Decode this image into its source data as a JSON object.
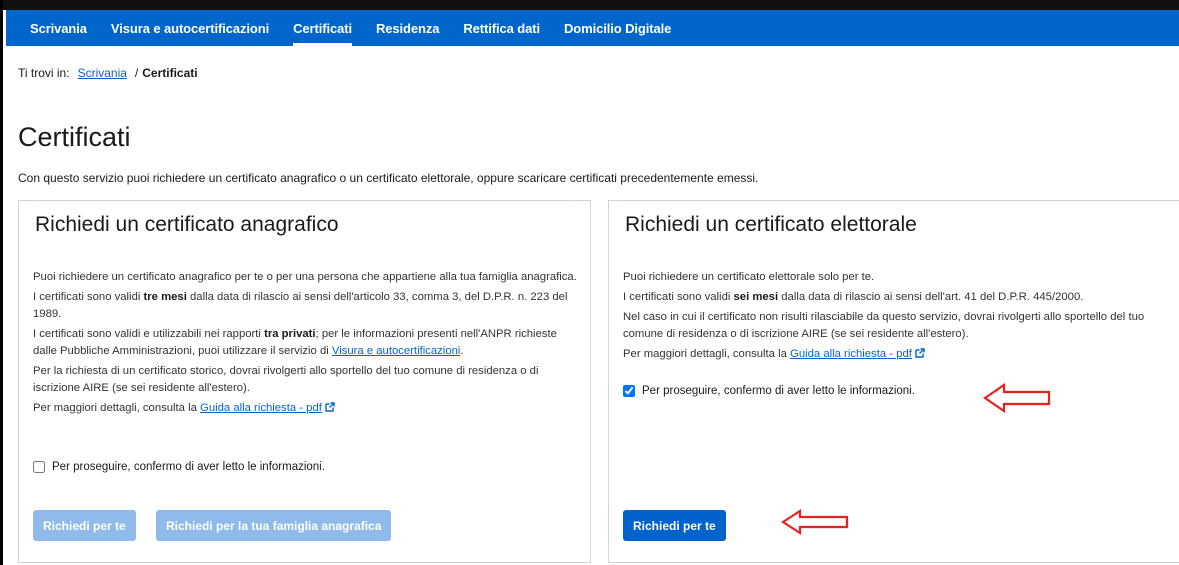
{
  "nav": {
    "items": [
      {
        "label": "Scrivania",
        "active": false
      },
      {
        "label": "Visura e autocertificazioni",
        "active": false
      },
      {
        "label": "Certificati",
        "active": true
      },
      {
        "label": "Residenza",
        "active": false
      },
      {
        "label": "Rettifica dati",
        "active": false
      },
      {
        "label": "Domicilio Digitale",
        "active": false
      }
    ]
  },
  "breadcrumb": {
    "prefix": "Ti trovi in:",
    "link": "Scrivania",
    "separator": "/",
    "current": "Certificati"
  },
  "page": {
    "title": "Certificati",
    "intro": "Con questo servizio puoi richiedere un certificato anagrafico o un certificato elettorale, oppure scaricare certificati precedentemente emessi."
  },
  "anagrafico": {
    "title": "Richiedi un certificato anagrafico",
    "p1": "Puoi richiedere un certificato anagrafico per te o per una persona che appartiene alla tua famiglia anagrafica.",
    "p2_before": "I certificati sono validi ",
    "p2_bold": "tre mesi",
    "p2_after": " dalla data di rilascio ai sensi dell'articolo 33, comma 3, del D.P.R. n. 223 del 1989.",
    "p3_before": "I certificati sono validi e utilizzabili nei rapporti ",
    "p3_bold": "tra privati",
    "p3_middle": "; per le informazioni presenti nell'ANPR richieste dalle Pubbliche Amministrazioni, puoi utilizzare il servizio di ",
    "p3_link": "Visura e autocertificazioni",
    "p3_end": ".",
    "p4": "Per la richiesta di un certificato storico, dovrai rivolgerti allo sportello del tuo comune di residenza o di iscrizione AIRE (se sei residente all'estero).",
    "p5_before": "Per maggiori dettagli, consulta la ",
    "p5_link": "Guida alla richiesta - pdf",
    "checkbox_label": "Per proseguire, confermo di aver letto le informazioni.",
    "checked": false,
    "btn_self": "Richiedi per te",
    "btn_family": "Richiedi per la tua famiglia anagrafica"
  },
  "elettorale": {
    "title": "Richiedi un certificato elettorale",
    "p1": "Puoi richiedere un certificato elettorale solo per te.",
    "p2_before": "I certificati sono validi ",
    "p2_bold": "sei mesi",
    "p2_after": " dalla data di rilascio ai sensi dell'art. 41 del D.P.R. 445/2000.",
    "p3": "Nel caso in cui il certificato non risulti rilasciabile da questo servizio, dovrai rivolgerti allo sportello del tuo comune di residenza o di iscrizione AIRE (se sei residente all'estero).",
    "p4_before": "Per maggiori dettagli, consulta la ",
    "p4_link": "Guida alla richiesta - pdf",
    "checkbox_label": "Per proseguire, confermo di aver letto le informazioni.",
    "checked": true,
    "btn_self": "Richiedi per te"
  },
  "colors": {
    "primary": "#0066cc",
    "disabled_button": "#8fbaea",
    "annotation_arrow": "#e8231f"
  },
  "icons": {
    "external_link": "external-link-icon",
    "annotation": "red-arrow-icon"
  }
}
